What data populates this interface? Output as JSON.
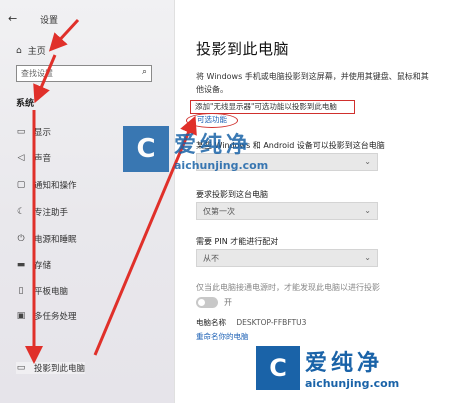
{
  "window": {
    "back_glyph": "←",
    "title": "设置"
  },
  "sidebar": {
    "home_icon": "home-icon",
    "home_label": "主页",
    "search_placeholder": "查找设置",
    "search_icon": "search-icon",
    "section_label": "系统",
    "items": [
      {
        "label": "显示",
        "icon": "monitor-icon",
        "glyph": "▭"
      },
      {
        "label": "声音",
        "icon": "speaker-icon",
        "glyph": "◁"
      },
      {
        "label": "通知和操作",
        "icon": "message-icon",
        "glyph": "▢"
      },
      {
        "label": "专注助手",
        "icon": "moon-icon",
        "glyph": "☾"
      },
      {
        "label": "电源和睡眠",
        "icon": "power-icon",
        "glyph": "⏻"
      },
      {
        "label": "存储",
        "icon": "storage-icon",
        "glyph": "▬"
      },
      {
        "label": "平板电脑",
        "icon": "tablet-icon",
        "glyph": "▯"
      },
      {
        "label": "多任务处理",
        "icon": "multitask-icon",
        "glyph": "▣"
      },
      {
        "label": "投影到此电脑",
        "icon": "project-icon",
        "glyph": "▭"
      }
    ]
  },
  "main": {
    "title": "投影到此电脑",
    "description": "将 Windows 手机或电脑投影到这屏幕，并使用其键盘、鼠标和其他设备。",
    "tip": "添加\"无线显示器\"可选功能以投影到此电脑",
    "optional_link": "可选功能",
    "setting1_label": "某些 Windows 和 Android 设备可以投影到这台电脑",
    "setting1_value": "",
    "setting2_label": "要求投影到这台电脑",
    "setting2_value": "仅第一次",
    "setting3_label": "需要 PIN 才能进行配对",
    "setting3_value": "从不",
    "setting4_label": "仅当此电脑接通电源时，才能发现此电脑以进行投影",
    "toggle_label": "开",
    "pc_name_label": "电脑名称",
    "pc_name_value": "DESKTOP-FFBFTU3",
    "rename_link": "重命名你的电脑"
  },
  "watermark": {
    "mark": "C",
    "name": "爱纯净",
    "url": "aichunjing.com"
  },
  "colors": {
    "accent": "#1a5fb4",
    "annotation": "#d0302d",
    "watermark": "#1a63a8"
  }
}
